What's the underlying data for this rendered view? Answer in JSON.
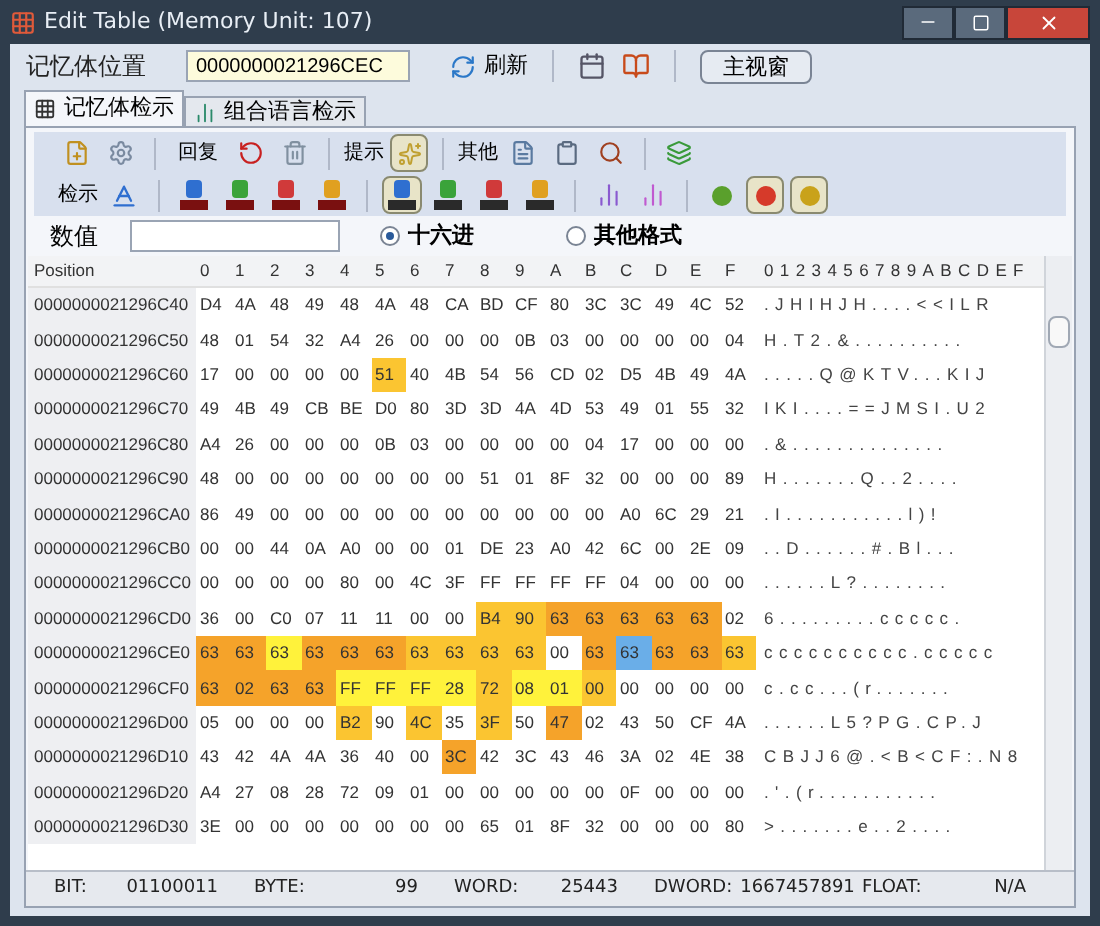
{
  "window": {
    "title": "Edit Table (Memory Unit: 107)"
  },
  "address_bar": {
    "label": "记忆体位置",
    "value": "0000000021296CEC",
    "refresh": "刷新",
    "main_window": "主视窗"
  },
  "tabs": [
    {
      "label": "记忆体检示",
      "selected": true
    },
    {
      "label": "组合语言检示",
      "selected": false
    }
  ],
  "toolbar": {
    "reply": "回复",
    "hint": "提示",
    "hint_pressed": true,
    "other": "其他",
    "view": "检示",
    "format_buttons": [
      {
        "kind": "dec",
        "color": "#2f6fd0",
        "pressed": false
      },
      {
        "kind": "dec",
        "color": "#3aa33a",
        "pressed": false
      },
      {
        "kind": "dec",
        "color": "#d03a3a",
        "pressed": false
      },
      {
        "kind": "dec",
        "color": "#e0a020",
        "pressed": false
      },
      {
        "kind": "hex",
        "color": "#2f6fd0",
        "pressed": true
      },
      {
        "kind": "hex",
        "color": "#3aa33a",
        "pressed": false
      },
      {
        "kind": "hex",
        "color": "#d03a3a",
        "pressed": false
      },
      {
        "kind": "hex",
        "color": "#e0a020",
        "pressed": false
      }
    ],
    "lights": [
      {
        "color": "#5aa02c",
        "pressed": false
      },
      {
        "color": "#d63a2a",
        "pressed": true
      },
      {
        "color": "#c9a21a",
        "pressed": true
      }
    ]
  },
  "value_row": {
    "label": "数值",
    "radios": [
      {
        "label": "十六进",
        "selected": true
      },
      {
        "label": "其他格式",
        "selected": false
      }
    ]
  },
  "table": {
    "position_header": "Position",
    "columns": [
      "0",
      "1",
      "2",
      "3",
      "4",
      "5",
      "6",
      "7",
      "8",
      "9",
      "A",
      "B",
      "C",
      "D",
      "E",
      "F"
    ],
    "text_header": "0123456789ABCDEF",
    "rows": [
      {
        "position": "0000000021296C40",
        "cells": [
          "D4",
          "4A",
          "48",
          "49",
          "48",
          "4A",
          "48",
          "CA",
          "BD",
          "CF",
          "80",
          "3C",
          "3C",
          "49",
          "4C",
          "52"
        ],
        "text": ".JHIHJH....<<ILR"
      },
      {
        "position": "0000000021296C50",
        "cells": [
          "48",
          "01",
          "54",
          "32",
          "A4",
          "26",
          "00",
          "00",
          "00",
          "0B",
          "03",
          "00",
          "00",
          "00",
          "00",
          "04"
        ],
        "text": "H.T2.&.........."
      },
      {
        "position": "0000000021296C60",
        "cells": [
          "17",
          "00",
          "00",
          "00",
          "00",
          {
            "v": "51",
            "color": "#fbc531"
          },
          "40",
          "4B",
          "54",
          "56",
          "CD",
          "02",
          "D5",
          "4B",
          "49",
          "4A"
        ],
        "text": ".....Q@KTV...KIJ"
      },
      {
        "position": "0000000021296C70",
        "cells": [
          "49",
          "4B",
          "49",
          "CB",
          "BE",
          "D0",
          "80",
          "3D",
          "3D",
          "4A",
          "4D",
          "53",
          "49",
          "01",
          "55",
          "32"
        ],
        "text": "IKI....==JMSI.U2"
      },
      {
        "position": "0000000021296C80",
        "cells": [
          "A4",
          "26",
          "00",
          "00",
          "00",
          "0B",
          "03",
          "00",
          "00",
          "00",
          "00",
          "04",
          "17",
          "00",
          "00",
          "00"
        ],
        "text": ".&.............."
      },
      {
        "position": "0000000021296C90",
        "cells": [
          "48",
          "00",
          "00",
          "00",
          "00",
          "00",
          "00",
          "00",
          "51",
          "01",
          "8F",
          "32",
          "00",
          "00",
          "00",
          "89"
        ],
        "text": "H.......Q..2...."
      },
      {
        "position": "0000000021296CA0",
        "cells": [
          "86",
          "49",
          "00",
          "00",
          "00",
          "00",
          "00",
          "00",
          "00",
          "00",
          "00",
          "00",
          "A0",
          "6C",
          "29",
          "21"
        ],
        "text": ".I...........l)!"
      },
      {
        "position": "0000000021296CB0",
        "cells": [
          "00",
          "00",
          "44",
          "0A",
          "A0",
          "00",
          "00",
          "01",
          "DE",
          "23",
          "A0",
          "42",
          "6C",
          "00",
          "2E",
          "09"
        ],
        "text": "..D......#.Bl..."
      },
      {
        "position": "0000000021296CC0",
        "cells": [
          "00",
          "00",
          "00",
          "00",
          "80",
          "00",
          "4C",
          "3F",
          "FF",
          "FF",
          "FF",
          "FF",
          "04",
          "00",
          "00",
          "00"
        ],
        "text": "......L?........"
      },
      {
        "position": "0000000021296CD0",
        "cells": [
          "36",
          "00",
          "C0",
          "07",
          "11",
          "11",
          "00",
          "00",
          {
            "v": "B4",
            "color": "#fbc531"
          },
          {
            "v": "90",
            "color": "#fbc531"
          },
          {
            "v": "63",
            "color": "#f5a32a"
          },
          {
            "v": "63",
            "color": "#f5a32a"
          },
          {
            "v": "63",
            "color": "#f5a32a"
          },
          {
            "v": "63",
            "color": "#f5a32a"
          },
          {
            "v": "63",
            "color": "#f5a32a"
          },
          "02"
        ],
        "text": "6.........ccccc."
      },
      {
        "position": "0000000021296CE0",
        "cells": [
          {
            "v": "63",
            "color": "#f5a32a"
          },
          {
            "v": "63",
            "color": "#f5a32a"
          },
          {
            "v": "63",
            "color": "#fff23b"
          },
          {
            "v": "63",
            "color": "#f5a32a"
          },
          {
            "v": "63",
            "color": "#f5a32a"
          },
          {
            "v": "63",
            "color": "#f5a32a"
          },
          {
            "v": "63",
            "color": "#fbc531"
          },
          {
            "v": "63",
            "color": "#fbc531"
          },
          {
            "v": "63",
            "color": "#fbc531"
          },
          {
            "v": "63",
            "color": "#fbc531"
          },
          "00",
          {
            "v": "63",
            "color": "#f5a32a"
          },
          {
            "v": "63",
            "color": "#6aaee8"
          },
          {
            "v": "63",
            "color": "#f5a32a"
          },
          {
            "v": "63",
            "color": "#f5a32a"
          },
          {
            "v": "63",
            "color": "#fbc531"
          }
        ],
        "text": "cccccccccc.ccccc"
      },
      {
        "position": "0000000021296CF0",
        "cells": [
          {
            "v": "63",
            "color": "#f5a32a"
          },
          {
            "v": "02",
            "color": "#f5a32a"
          },
          {
            "v": "63",
            "color": "#f5a32a"
          },
          {
            "v": "63",
            "color": "#f5a32a"
          },
          {
            "v": "FF",
            "color": "#fff23b"
          },
          {
            "v": "FF",
            "color": "#fff23b"
          },
          {
            "v": "FF",
            "color": "#fff23b"
          },
          {
            "v": "28",
            "color": "#fff23b"
          },
          {
            "v": "72",
            "color": "#fbc531"
          },
          {
            "v": "08",
            "color": "#fff23b"
          },
          {
            "v": "01",
            "color": "#fff23b"
          },
          {
            "v": "00",
            "color": "#fbc531"
          },
          "00",
          "00",
          "00",
          "00"
        ],
        "text": "c.cc...(r......."
      },
      {
        "position": "0000000021296D00",
        "cells": [
          "05",
          "00",
          "00",
          "00",
          {
            "v": "B2",
            "color": "#fbc531"
          },
          "90",
          {
            "v": "4C",
            "color": "#fbc531"
          },
          "35",
          {
            "v": "3F",
            "color": "#fbc531"
          },
          "50",
          {
            "v": "47",
            "color": "#f5a32a"
          },
          "02",
          "43",
          "50",
          "CF",
          "4A"
        ],
        "text": "......L5?PG.CP.J"
      },
      {
        "position": "0000000021296D10",
        "cells": [
          "43",
          "42",
          "4A",
          "4A",
          "36",
          "40",
          "00",
          {
            "v": "3C",
            "color": "#f5a32a"
          },
          "42",
          "3C",
          "43",
          "46",
          "3A",
          "02",
          "4E",
          "38"
        ],
        "text": "CBJJ6@.<B<CF:.N8"
      },
      {
        "position": "0000000021296D20",
        "cells": [
          "A4",
          "27",
          "08",
          "28",
          "72",
          "09",
          "01",
          "00",
          "00",
          "00",
          "00",
          "00",
          "0F",
          "00",
          "00",
          "00"
        ],
        "text": ".'.(r..........."
      },
      {
        "position": "0000000021296D30",
        "cells": [
          "3E",
          "00",
          "00",
          "00",
          "00",
          "00",
          "00",
          "00",
          "65",
          "01",
          "8F",
          "32",
          "00",
          "00",
          "00",
          "80"
        ],
        "text": ">.......e..2...."
      }
    ]
  },
  "status_bar": [
    {
      "label": "BIT:",
      "value": "01100011"
    },
    {
      "label": "BYTE:",
      "value": "99"
    },
    {
      "label": "WORD:",
      "value": "25443"
    },
    {
      "label": "DWORD:",
      "value": "1667457891"
    },
    {
      "label": "FLOAT:",
      "value": "N/A"
    }
  ]
}
